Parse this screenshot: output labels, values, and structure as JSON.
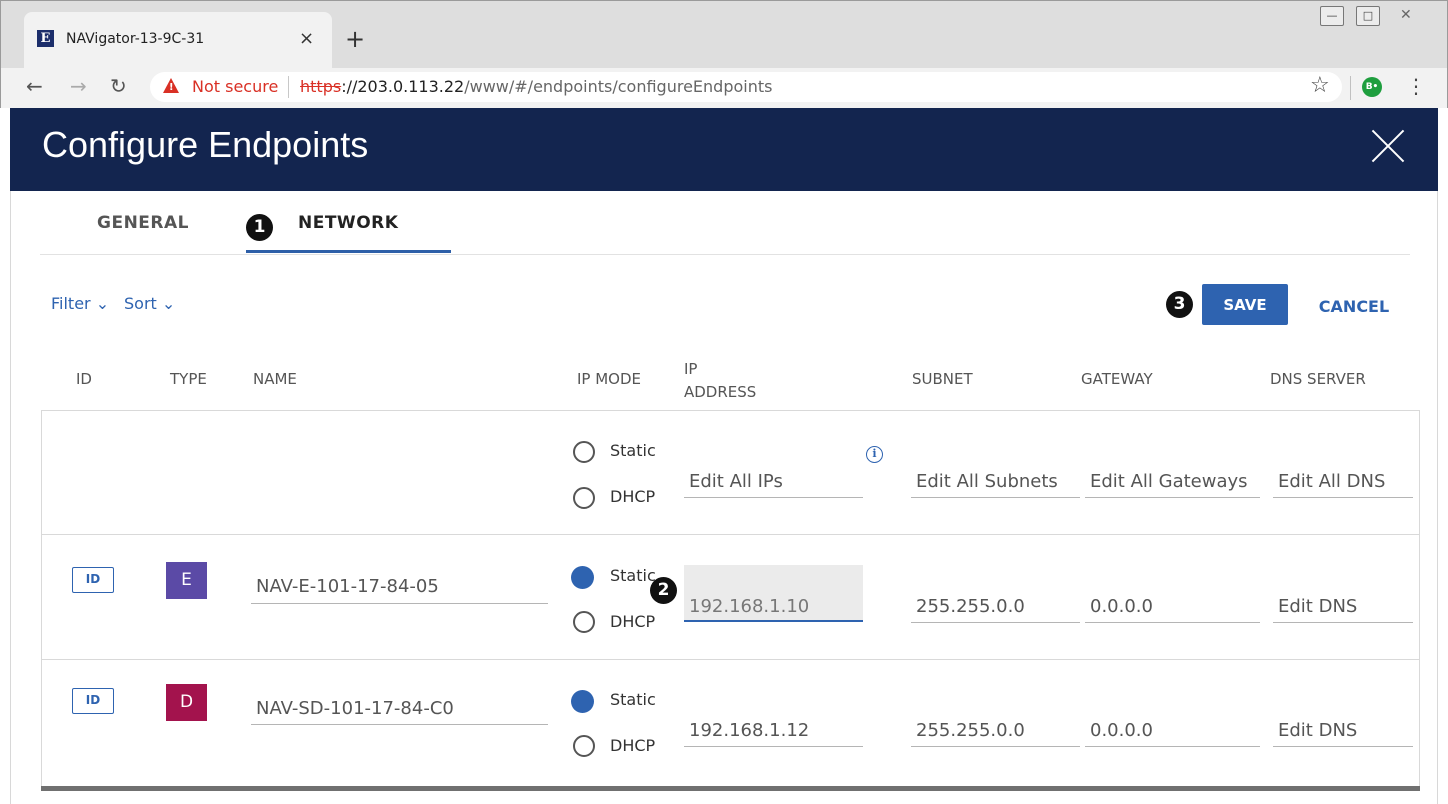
{
  "browser": {
    "tab_title": "NAVigator-13-9C-31",
    "favicon_letter": "E",
    "new_tab_label": "+",
    "close_tab_label": "×",
    "security_label": "Not secure",
    "url_protocol": "https",
    "url_host": "://203.0.113.22",
    "url_path": "/www/#/endpoints/configureEndpoints",
    "extension_label": "B•"
  },
  "header": {
    "title": "Configure Endpoints"
  },
  "tabs": [
    {
      "label": "GENERAL",
      "active": false
    },
    {
      "label": "NETWORK",
      "active": true
    }
  ],
  "callouts": [
    "1",
    "2",
    "3"
  ],
  "toolbar": {
    "filter_label": "Filter",
    "sort_label": "Sort",
    "save_label": "SAVE",
    "cancel_label": "CANCEL"
  },
  "columns": {
    "id": "ID",
    "type": "TYPE",
    "name": "NAME",
    "ip_mode": "IP MODE",
    "ip_address_1": "IP",
    "ip_address_2": "ADDRESS",
    "subnet": "SUBNET",
    "gateway": "GATEWAY",
    "dns": "DNS SERVER"
  },
  "bulk_row": {
    "static_label": "Static",
    "dhcp_label": "DHCP",
    "ip": "Edit All IPs",
    "subnet": "Edit All Subnets",
    "gateway": "Edit All Gateways",
    "dns": "Edit All DNS",
    "info_icon": "i"
  },
  "rows": [
    {
      "id_label": "ID",
      "type": "E",
      "type_color": "#5b4aa6",
      "name": "NAV-E-101-17-84-05",
      "static_label": "Static",
      "dhcp_label": "DHCP",
      "mode": "Static",
      "ip": "192.168.1.10",
      "subnet": "255.255.0.0",
      "gateway": "0.0.0.0",
      "dns": "Edit DNS"
    },
    {
      "id_label": "ID",
      "type": "D",
      "type_color": "#a3134d",
      "name": "NAV-SD-101-17-84-C0",
      "static_label": "Static",
      "dhcp_label": "DHCP",
      "mode": "Static",
      "ip": "192.168.1.12",
      "subnet": "255.255.0.0",
      "gateway": "0.0.0.0",
      "dns": "Edit DNS"
    }
  ],
  "colors": {
    "header_bg": "#13254f",
    "accent": "#2e63b0",
    "warning": "#d93025"
  }
}
